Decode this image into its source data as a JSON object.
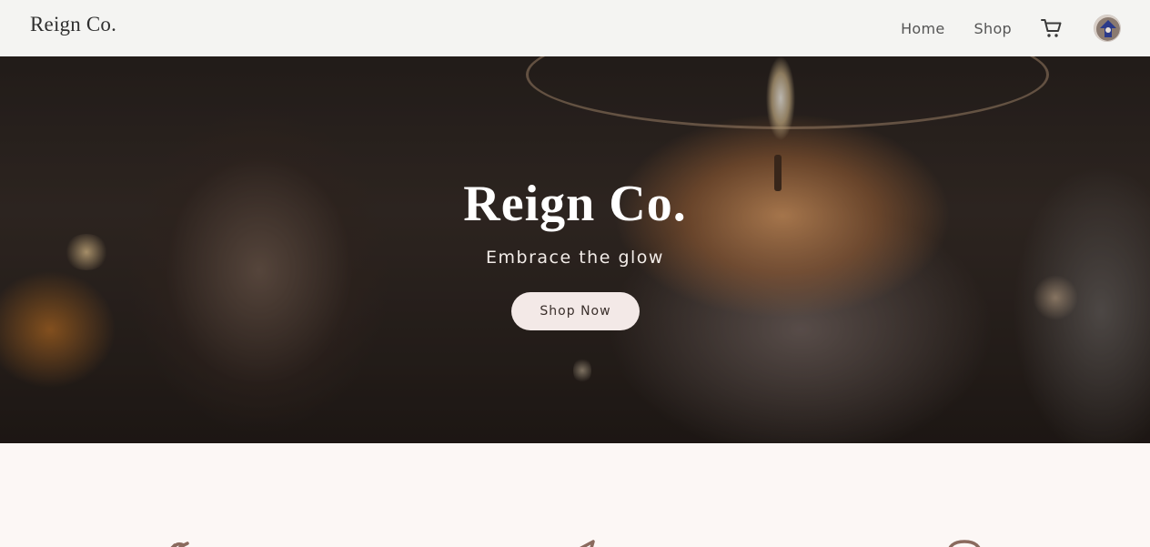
{
  "header": {
    "brand": "Reign Co.",
    "nav": [
      {
        "label": "Home"
      },
      {
        "label": "Shop"
      }
    ],
    "icons": {
      "cart": "cart-icon",
      "avatar": "user-avatar"
    }
  },
  "hero": {
    "title": "Reign Co.",
    "tagline": "Embrace the glow",
    "cta_label": "Shop Now"
  },
  "features": {
    "icons": [
      "wand-icon",
      "send-icon",
      "support-icon"
    ]
  },
  "colors": {
    "accent": "#f3e9e7",
    "text_dark": "#2f2f2f",
    "icon_brown": "#8a6a5e",
    "section_bg": "#fcf7f5"
  }
}
